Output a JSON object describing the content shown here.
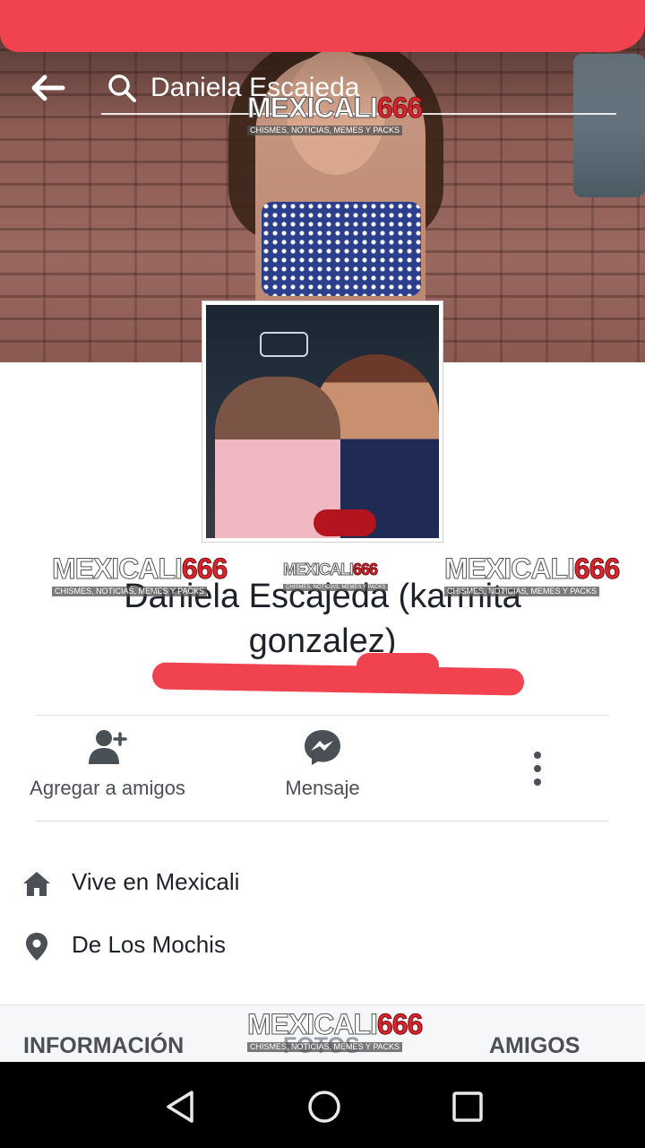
{
  "search": {
    "query": "Daniela Escajeda"
  },
  "watermark": {
    "brand": "MEXICALI",
    "number": "666",
    "tagline": "CHISMES, NOTICIAS, MEMES Y PACKS"
  },
  "profile": {
    "name": "Daniela Escajeda (karmita gonzalez)"
  },
  "actions": [
    {
      "label": "Agregar a amigos",
      "icon": "add-friend-icon"
    },
    {
      "label": "Mensaje",
      "icon": "messenger-icon"
    },
    {
      "label": "",
      "icon": "more-vertical-icon"
    }
  ],
  "info": [
    {
      "icon": "home-icon",
      "text": "Vive en Mexicali"
    },
    {
      "icon": "location-pin-icon",
      "text": "De Los Mochis"
    }
  ],
  "tabs": [
    {
      "label": "INFORMACIÓN"
    },
    {
      "label": "FOTOS"
    },
    {
      "label": "AMIGOS"
    }
  ],
  "colors": {
    "redacted_mark": "#f0424f",
    "nav_bg": "#000000",
    "icon_gray": "#4b4f56"
  }
}
